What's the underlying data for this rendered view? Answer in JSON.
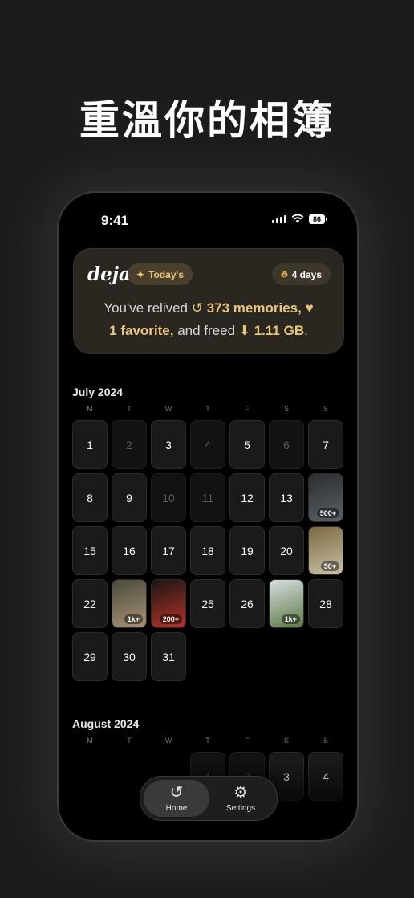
{
  "headline": "重溫你的相簿",
  "status": {
    "time": "9:41",
    "battery": "86"
  },
  "card": {
    "logo": "deja",
    "today_label": "Today's",
    "streak_label": "4 days",
    "summary": {
      "p1": "You've relived ",
      "memories": "373 memories,",
      "favorite": "1 favorite,",
      "p2": " and freed ",
      "freed": "1.11 GB",
      "p3": "."
    }
  },
  "weekday_labels": [
    "M",
    "T",
    "W",
    "T",
    "F",
    "S",
    "S"
  ],
  "months": [
    {
      "title": "July 2024",
      "days": [
        {
          "label": "1",
          "dim": false
        },
        {
          "label": "2",
          "dim": true
        },
        {
          "label": "3",
          "dim": false
        },
        {
          "label": "4",
          "dim": true
        },
        {
          "label": "5",
          "dim": false
        },
        {
          "label": "6",
          "dim": true
        },
        {
          "label": "7",
          "dim": false
        },
        {
          "label": "8",
          "dim": false
        },
        {
          "label": "9",
          "dim": false
        },
        {
          "label": "10",
          "dim": true
        },
        {
          "label": "11",
          "dim": true
        },
        {
          "label": "12",
          "dim": false
        },
        {
          "label": "13",
          "dim": false
        },
        {
          "label": "",
          "photo": true,
          "count": "500+",
          "colors": [
            "#2a2d30",
            "#5b6166"
          ]
        },
        {
          "label": "15",
          "dim": false
        },
        {
          "label": "16",
          "dim": false
        },
        {
          "label": "17",
          "dim": false
        },
        {
          "label": "18",
          "dim": false
        },
        {
          "label": "19",
          "dim": false
        },
        {
          "label": "20",
          "dim": false
        },
        {
          "label": "",
          "photo": true,
          "count": "50+",
          "colors": [
            "#7a6a3e",
            "#c9c0a6"
          ]
        },
        {
          "label": "22",
          "dim": false
        },
        {
          "label": "",
          "photo": true,
          "count": "1k+",
          "colors": [
            "#4a4a3a",
            "#a89276"
          ]
        },
        {
          "label": "",
          "photo": true,
          "count": "200+",
          "colors": [
            "#1a1512",
            "#b5342a"
          ]
        },
        {
          "label": "25",
          "dim": false
        },
        {
          "label": "26",
          "dim": false
        },
        {
          "label": "",
          "photo": true,
          "count": "1k+",
          "colors": [
            "#d8dde2",
            "#5b7a45"
          ]
        },
        {
          "label": "28",
          "dim": false
        },
        {
          "label": "29",
          "dim": false
        },
        {
          "label": "30",
          "dim": false
        },
        {
          "label": "31",
          "dim": false
        }
      ]
    },
    {
      "title": "August 2024",
      "offset": 3,
      "days": [
        {
          "label": "1",
          "dim": true
        },
        {
          "label": "2",
          "dim": true
        },
        {
          "label": "3",
          "dim": false
        },
        {
          "label": "4",
          "dim": false
        }
      ]
    }
  ],
  "tabs": {
    "home": "Home",
    "settings": "Settings"
  },
  "colors": {
    "accent": "#e8c577",
    "background": "#1c1c1c",
    "card": "#2a2620"
  }
}
